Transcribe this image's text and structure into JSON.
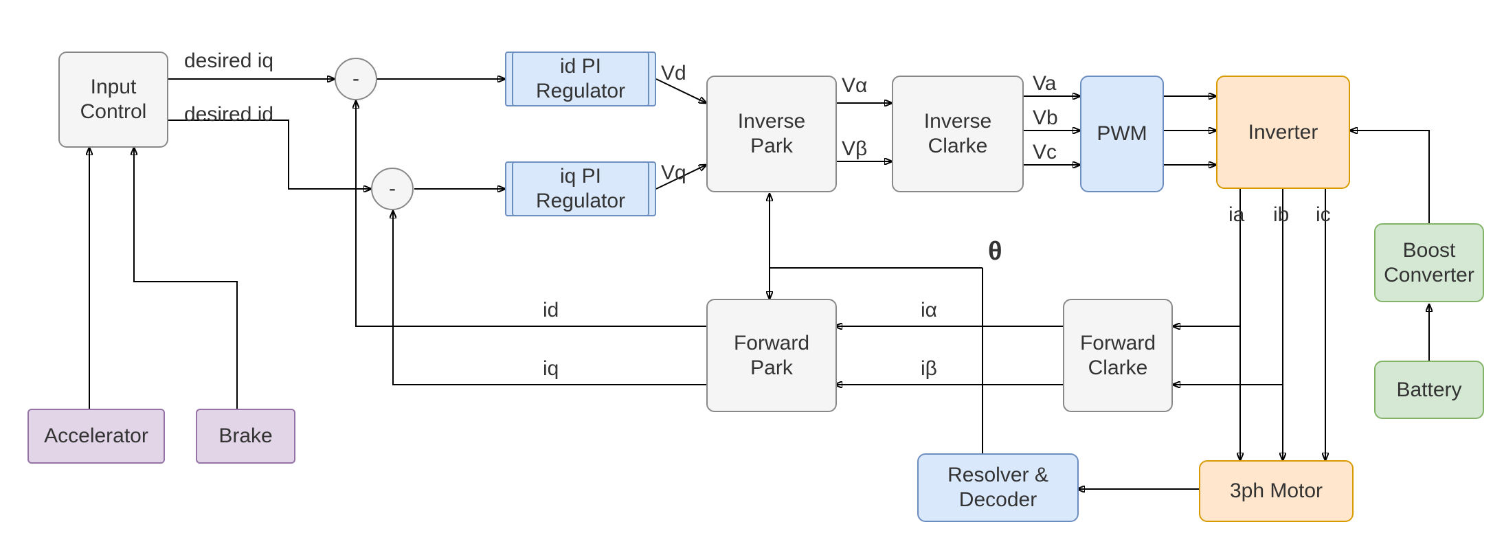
{
  "blocks": {
    "input_control": "Input\nControl",
    "accelerator": "Accelerator",
    "brake": "Brake",
    "id_pi": "id PI\nRegulator",
    "iq_pi": "iq PI\nRegulator",
    "inv_park": "Inverse\nPark",
    "inv_clarke": "Inverse\nClarke",
    "pwm": "PWM",
    "inverter": "Inverter",
    "boost": "Boost\nConverter",
    "battery": "Battery",
    "fwd_park": "Forward\nPark",
    "fwd_clarke": "Forward\nClarke",
    "resolver": "Resolver &\nDecoder",
    "motor": "3ph Motor"
  },
  "labels": {
    "desired_iq": "desired iq",
    "desired_id": "desired id",
    "vd": "Vd",
    "vq": "Vq",
    "valpha": "Vα",
    "vbeta": "Vβ",
    "va": "Va",
    "vb": "Vb",
    "vc": "Vc",
    "ia": "ia",
    "ib": "ib",
    "ic": "ic",
    "id": "id",
    "iq": "iq",
    "ialpha": "iα",
    "ibeta": "iβ",
    "theta": "θ",
    "minus": "-"
  }
}
